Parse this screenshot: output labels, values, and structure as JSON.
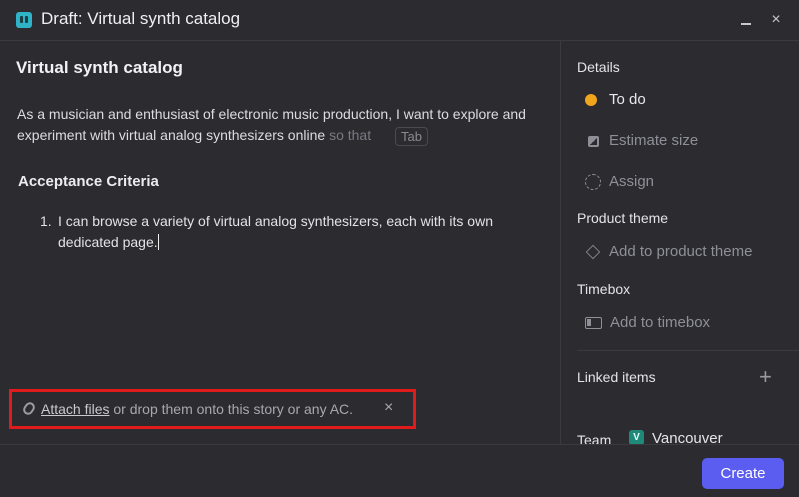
{
  "window": {
    "title": "Draft: Virtual synth catalog",
    "close_glyph": "×"
  },
  "story": {
    "title": "Virtual synth catalog",
    "description": "As a musician and enthusiast of electronic music production, I want to explore and experiment with virtual analog synthesizers online",
    "suggestion": "so that",
    "tab_hint": "Tab"
  },
  "acceptance_criteria": {
    "heading": "Acceptance Criteria",
    "items": [
      {
        "number": "1.",
        "text": "I can browse a variety of virtual analog synthesizers, each with its own dedicated page."
      }
    ]
  },
  "attach": {
    "link": "Attach files",
    "text": " or drop them onto this story or any AC.",
    "close_glyph": "×"
  },
  "sidebar": {
    "details_label": "Details",
    "status": "To do",
    "estimate": "Estimate size",
    "assign": "Assign",
    "product_theme_label": "Product theme",
    "product_theme_action": "Add to product theme",
    "timebox_label": "Timebox",
    "timebox_action": "Add to timebox",
    "linked_items_label": "Linked items",
    "add_glyph": "+",
    "team_label": "Team",
    "team_initial": "V",
    "team_name": "Vancouver"
  },
  "footer": {
    "create_label": "Create"
  },
  "colors": {
    "accent": "#5b5cf0",
    "status_todo": "#f0a51c",
    "highlight": "#e01b1b",
    "team": "#1f8a7a"
  }
}
